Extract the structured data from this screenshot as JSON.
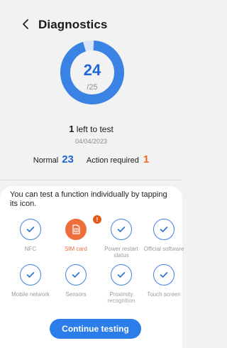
{
  "header": {
    "title": "Diagnostics"
  },
  "summary": {
    "tested": "24",
    "total": "/25",
    "left_count": "1",
    "left_text": " left to test",
    "date": "04/04/2023",
    "normal_label": "Normal",
    "normal_count": "23",
    "action_label": "Action required",
    "action_count": "1",
    "progress_fraction": 0.96
  },
  "hint": "You can test a function individually by tapping its icon.",
  "tests": [
    {
      "label": "NFC",
      "status": "normal",
      "icon": "check-icon"
    },
    {
      "label": "SIM card",
      "status": "action",
      "icon": "sim-card-icon",
      "badge": "!"
    },
    {
      "label": "Power restart status",
      "status": "normal",
      "icon": "check-icon"
    },
    {
      "label": "Official software",
      "status": "normal",
      "icon": "check-icon"
    },
    {
      "label": "Mobile network",
      "status": "normal",
      "icon": "check-icon"
    },
    {
      "label": "Sensors",
      "status": "normal",
      "icon": "check-icon"
    },
    {
      "label": "Proximity recognition",
      "status": "normal",
      "icon": "check-icon"
    },
    {
      "label": "Touch screen",
      "status": "normal",
      "icon": "check-icon"
    }
  ],
  "continue_button": "Continue testing",
  "colors": {
    "accent": "#1f67d8",
    "button": "#2b7de9",
    "warning": "#f06a26",
    "background": "#f2f2f2"
  }
}
